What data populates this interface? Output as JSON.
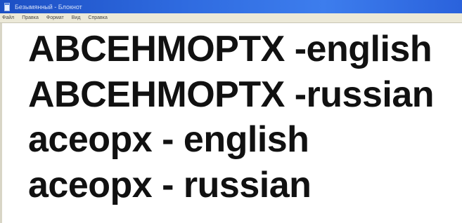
{
  "window": {
    "title": "Безымянный - Блокнот"
  },
  "menu": {
    "items": [
      "Файл",
      "Правка",
      "Формат",
      "Вид",
      "Справка"
    ]
  },
  "document": {
    "lines": [
      "ABCEHMOPTX -english",
      "ABCEHMOPTX -russian",
      "aceopx - english",
      "aceopx - russian"
    ]
  },
  "icons": {
    "app": "notepad-icon"
  },
  "colors": {
    "titlebar": "#2f6be0",
    "menubar": "#ece9d8",
    "text": "#111111"
  }
}
